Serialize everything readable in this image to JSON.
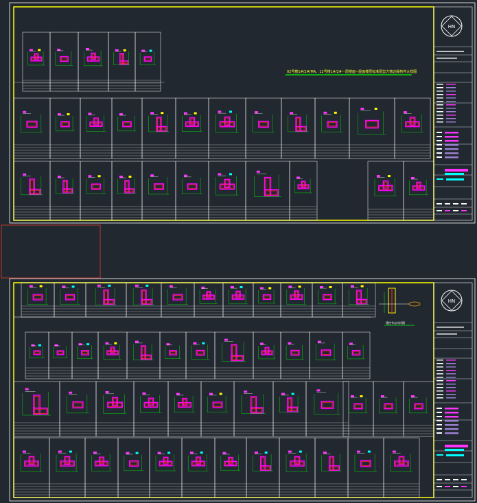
{
  "sheet1": {
    "title": "02号楼1#/2#/MA、12号楼1#/2#一层楼面~屋面楼层标准层剪力墙边缘构件大样图",
    "logo_text": "HN",
    "title_block_lines": 14
  },
  "sheet2": {
    "logo_text": "HN",
    "detail_caption": "墙柱节点大样图",
    "title_block_lines": 14
  },
  "colors": {
    "background": "#212830",
    "frame": "#ffffff",
    "border": "#ffff00",
    "wall": "#ff00ff",
    "rebar": "#ff2a2a",
    "dim": "#00ff00",
    "text": "#ffffff",
    "accent_cyan": "#00ffff",
    "accent_magenta": "#ff33ff",
    "viewport": "#c0392b"
  }
}
